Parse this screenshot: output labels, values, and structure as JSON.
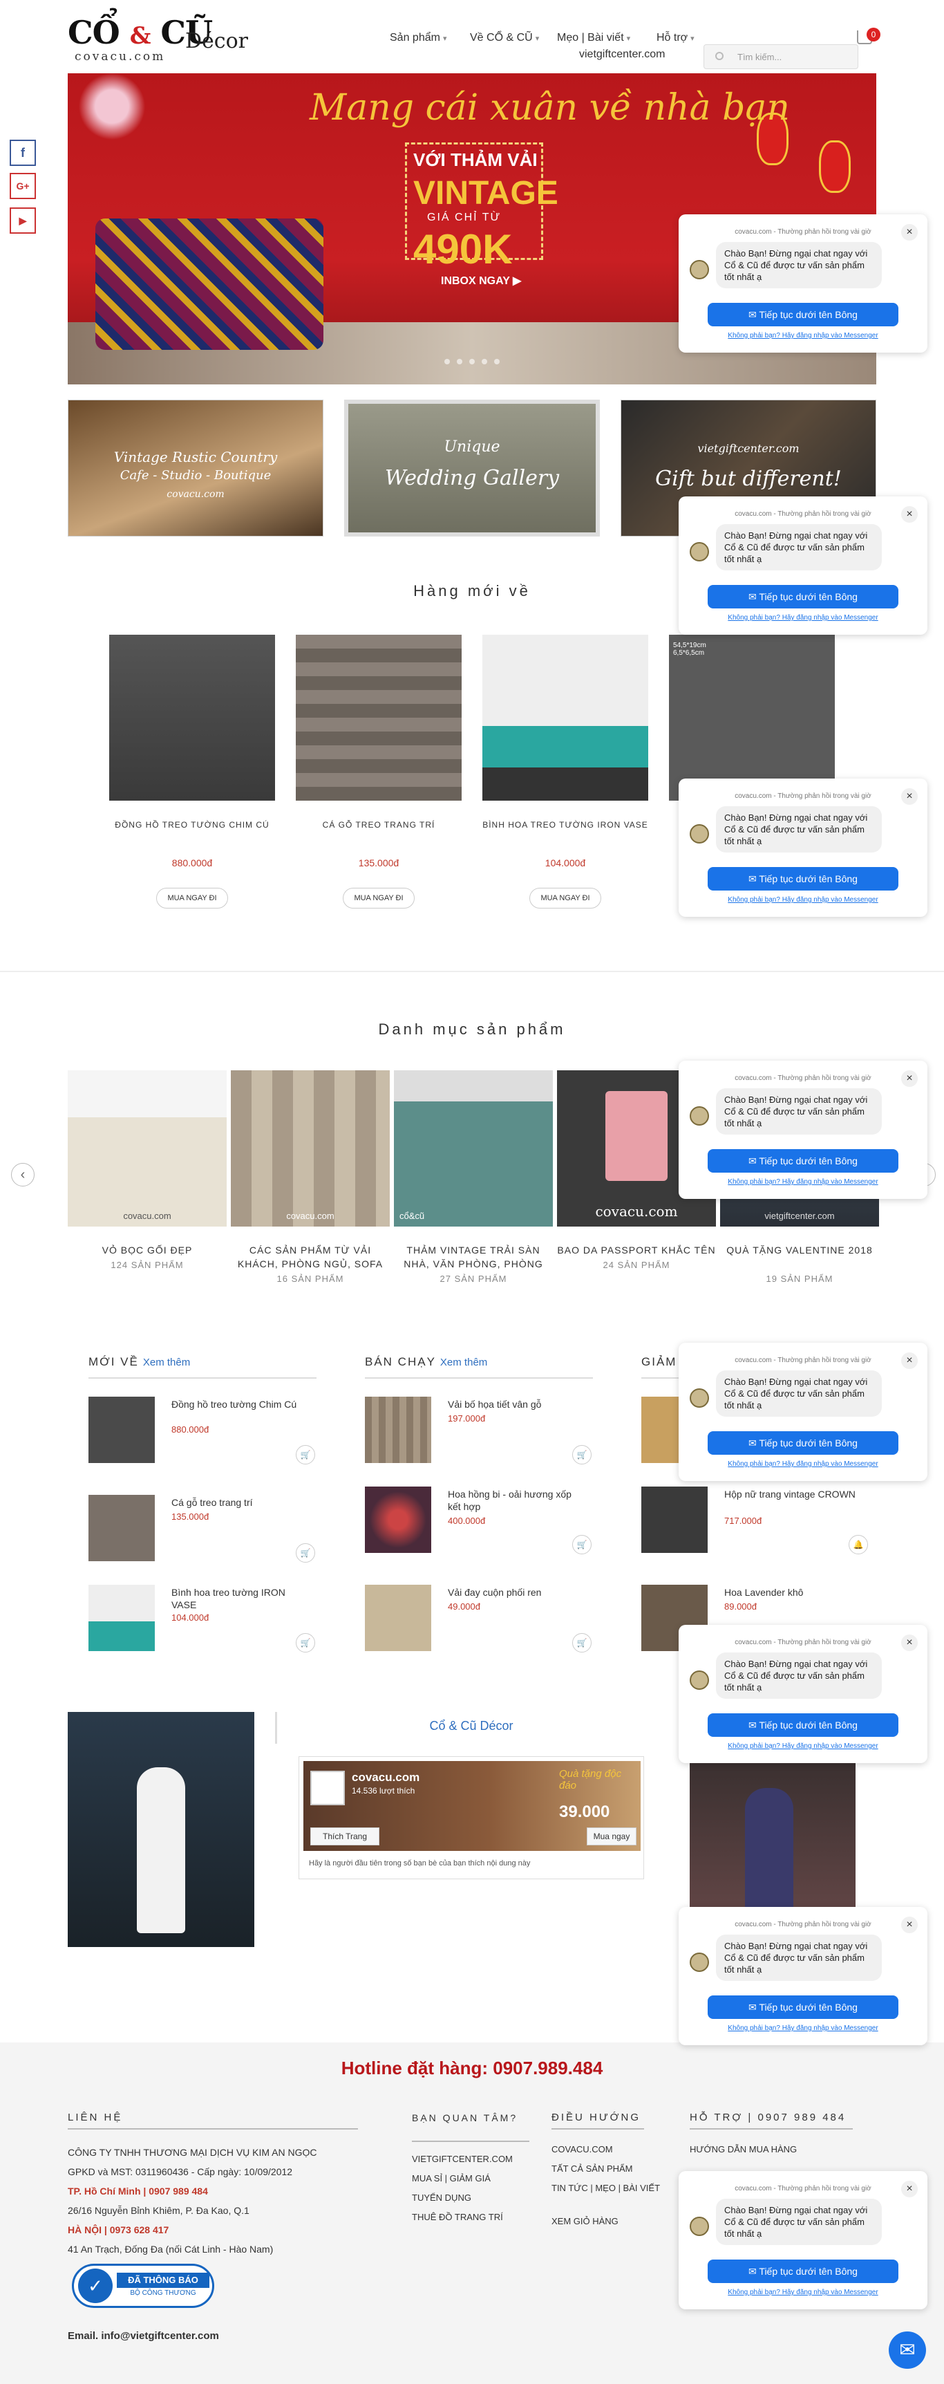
{
  "header": {
    "logo": {
      "part1": "CỔ",
      "amp": "&",
      "part2": "CŨ",
      "decor": "Décor",
      "site": "covacu.com"
    },
    "nav": [
      {
        "label": "Sản phẩm"
      },
      {
        "label": "Về CỔ & CŨ"
      },
      {
        "label": "Mẹo | Bài viết"
      },
      {
        "label": "Hỗ trợ"
      }
    ],
    "nav_site": "vietgiftcenter.com",
    "search_placeholder": "Tìm kiếm...",
    "cart_count": "0"
  },
  "social": [
    "f",
    "G+",
    "▶"
  ],
  "hero": {
    "title": "Mang cái xuân về nhà bạn",
    "line1": "VỚI THẢM VẢI",
    "line2": "VINTAGE",
    "line3": "GIÁ CHỈ TỪ",
    "price": "490K",
    "cta": "INBOX NGAY ▶"
  },
  "banners": [
    {
      "title": "Vintage Rustic Country",
      "sub": "Cafe - Studio - Boutique",
      "site": "covacu.com"
    },
    {
      "title": "Unique",
      "sub": "Wedding Gallery"
    },
    {
      "title": "vietgiftcenter.com",
      "sub": "Gift but different!"
    }
  ],
  "new_arrivals": {
    "title": "Hàng mới về",
    "items": [
      {
        "name": "ĐỒNG HỒ TREO TƯỜNG CHIM CÚ",
        "price": "880.000đ",
        "button": "MUA NGAY ĐI"
      },
      {
        "name": "CÁ GỖ TREO TRANG TRÍ",
        "price": "135.000đ",
        "button": "MUA NGAY ĐI"
      },
      {
        "name": "BÌNH HOA TREO TƯỜNG IRON VASE",
        "price": "104.000đ",
        "button": "MUA NGAY ĐI"
      },
      {
        "name": "",
        "price": "",
        "button": "",
        "dims": "54,5*19cm\n6,5*6,5cm"
      }
    ]
  },
  "categories": {
    "title": "Danh mục sản phẩm",
    "items": [
      {
        "name": "VỎ BỌC GỐI ĐẸP",
        "count": "124 SẢN PHẨM"
      },
      {
        "name": "CÁC SẢN PHẨM TỪ VẢI KHÁCH, PHÒNG NGỦ, SOFA",
        "count": "16 SẢN PHẨM"
      },
      {
        "name": "THẢM VINTAGE TRẢI SÀN NHÀ, VĂN PHÒNG, PHÒNG",
        "count": "27 SẢN PHẨM"
      },
      {
        "name": "BAO DA PASSPORT KHẮC TÊN",
        "count": "24 SẢN PHẨM"
      },
      {
        "name": "QUÀ TẶNG VALENTINE 2018",
        "count": "19 SẢN PHẨM"
      }
    ],
    "watermarks": [
      "covacu.com",
      "covacu.com",
      "cổ&cũ",
      "covacu.com",
      "vietgiftcenter.com"
    ]
  },
  "columns": {
    "new": {
      "title": "MỚI VỀ",
      "more": "Xem thêm",
      "items": [
        {
          "name": "Đồng hồ treo tường Chim Cú",
          "price": "880.000đ"
        },
        {
          "name": "Cá gỗ treo trang trí",
          "price": "135.000đ"
        },
        {
          "name": "Bình hoa treo tường IRON VASE",
          "price": "104.000đ"
        }
      ]
    },
    "best": {
      "title": "BÁN CHẠY",
      "more": "Xem thêm",
      "items": [
        {
          "name": "Vải bố họa tiết vân gỗ",
          "price": "197.000đ"
        },
        {
          "name": "Hoa hồng bi - oải hương xốp kết hợp",
          "price": "400.000đ"
        },
        {
          "name": "Vải đay cuộn phối ren",
          "price": "49.000đ"
        }
      ]
    },
    "sale": {
      "title": "GIẢM",
      "items": [
        {
          "name": "",
          "price": ""
        },
        {
          "name": "Hộp nữ trang vintage CROWN",
          "price": "717.000đ"
        },
        {
          "name": "Hoa Lavender khô",
          "price": "89.000đ"
        }
      ]
    }
  },
  "social_section": {
    "fb_title": "Cổ & Cũ Décor",
    "fb_page": "covacu.com",
    "fb_likes": "14.536 lượt thích",
    "fb_like_button": "Thích Trang",
    "fb_footer": "Hãy là người đầu tiên trong số bạn bè của bạn thích nội dung này",
    "promo_text": "Quà tặng độc đáo",
    "promo_price": "39.000",
    "promo_button": "Mua ngay"
  },
  "footer": {
    "hotline": "Hotline đặt hàng: 0907.989.484",
    "contact": {
      "title": "LIÊN HỆ",
      "company": "CÔNG TY TNHH THƯƠNG MẠI DỊCH VỤ KIM AN NGỌC",
      "license": "GPKD và MST: 0311960436 - Cấp ngày: 10/09/2012",
      "hcm": "TP. Hồ Chí Minh | 0907 989 484",
      "hcm_addr": "26/16 Nguyễn Bỉnh Khiêm, P. Đa Kao, Q.1",
      "hn": "HÀ NỘI | 0973 628 417",
      "hn_addr": "41 An Trạch, Đống Đa (nối Cát Linh - Hào Nam)",
      "badge": "ĐÃ THÔNG BÁO",
      "badge_sub": "BỘ CÔNG THƯƠNG",
      "email": "Email. info@vietgiftcenter.com"
    },
    "partners": {
      "title": "BẠN QUAN TÂM?",
      "links": [
        "VIETGIFTCENTER.COM",
        "MUA SỈ | GIẢM GIÁ",
        "TUYỂN DỤNG",
        "THUÊ ĐỒ TRANG TRÍ"
      ]
    },
    "nav": {
      "title": "ĐIỀU HƯỚNG",
      "links": [
        "COVACU.COM",
        "TẤT CẢ SẢN PHẨM",
        "TIN TỨC | MẸO | BÀI VIẾT",
        "XEM GIỎ HÀNG"
      ]
    },
    "support": {
      "title": "HỖ TRỢ | 0907 989 484",
      "links": [
        "HƯỚNG DẪN MUA HÀNG"
      ]
    }
  },
  "chat": {
    "top": "covacu.com - Thường phản hồi trong vài giờ",
    "message": "Chào Bạn! Đừng ngại chat ngay với Cổ & Cũ để được tư vấn sản phẩm tốt nhất ạ",
    "cta": "Tiếp tục dưới tên Bông",
    "sub": "Không phải bạn? Hãy đăng nhập vào Messenger"
  }
}
